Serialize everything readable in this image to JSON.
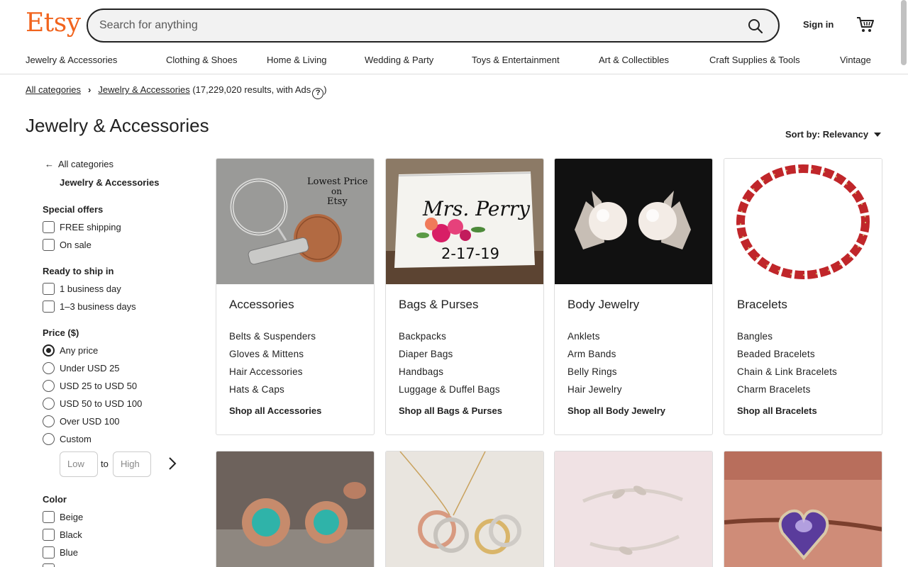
{
  "header": {
    "logo": "Etsy",
    "search_placeholder": "Search for anything",
    "sign_in": "Sign in",
    "nav": [
      "Jewelry & Accessories",
      "Clothing & Shoes",
      "Home & Living",
      "Wedding & Party",
      "Toys & Entertainment",
      "Art & Collectibles",
      "Craft Supplies & Tools",
      "Vintage"
    ]
  },
  "breadcrumb": {
    "root": "All categories",
    "current": "Jewelry & Accessories",
    "results": "(17,229,020 results, with Ads",
    "close": ")"
  },
  "page_title": "Jewelry & Accessories",
  "sort": "Sort by: Relevancy",
  "sidebar": {
    "back": "All categories",
    "current": "Jewelry & Accessories",
    "special_offers": {
      "title": "Special offers",
      "options": [
        "FREE shipping",
        "On sale"
      ]
    },
    "ready_to_ship": {
      "title": "Ready to ship in",
      "options": [
        "1 business day",
        "1–3 business days"
      ]
    },
    "price": {
      "title": "Price ($)",
      "options": [
        "Any price",
        "Under USD 25",
        "USD 25 to USD 50",
        "USD 50 to USD 100",
        "Over USD 100",
        "Custom"
      ],
      "selected": "Any price",
      "low_placeholder": "Low",
      "to": "to",
      "high_placeholder": "High"
    },
    "color": {
      "title": "Color",
      "options": [
        "Beige",
        "Black",
        "Blue"
      ]
    }
  },
  "categories": [
    {
      "title": "Accessories",
      "items": [
        "Belts & Suspenders",
        "Gloves & Mittens",
        "Hair Accessories",
        "Hats & Caps"
      ],
      "shop_all": "Shop all Accessories",
      "image_text": [
        "Lowest Price",
        "on",
        "Etsy"
      ]
    },
    {
      "title": "Bags & Purses",
      "items": [
        "Backpacks",
        "Diaper Bags",
        "Handbags",
        "Luggage & Duffel Bags"
      ],
      "shop_all": "Shop all Bags & Purses",
      "image_text": [
        "Mrs. Perry",
        "2-17-19"
      ]
    },
    {
      "title": "Body Jewelry",
      "items": [
        "Anklets",
        "Arm Bands",
        "Belly Rings",
        "Hair Jewelry"
      ],
      "shop_all": "Shop all Body Jewelry"
    },
    {
      "title": "Bracelets",
      "items": [
        "Bangles",
        "Beaded Bracelets",
        "Chain & Link Bracelets",
        "Charm Bracelets"
      ],
      "shop_all": "Shop all Bracelets"
    }
  ],
  "colors": {
    "brand": "#F1641E",
    "text": "#222222",
    "border": "#dddddd"
  }
}
